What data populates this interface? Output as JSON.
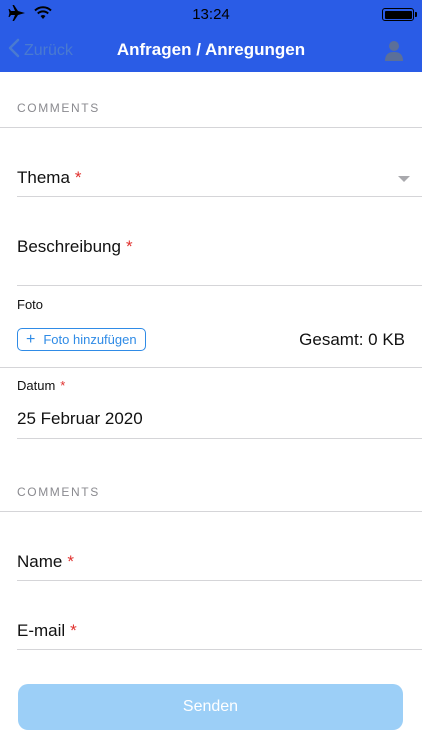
{
  "status_bar": {
    "time": "13:24"
  },
  "nav": {
    "back_label": "Zurück",
    "title": "Anfragen / Anregungen"
  },
  "section1": {
    "header": "COMMENTS",
    "thema_label": "Thema",
    "beschreibung_label": "Beschreibung",
    "foto_label": "Foto",
    "add_photo_label": "Foto hinzufügen",
    "total_label": "Gesamt: 0 KB",
    "datum_label": "Datum",
    "datum_value": "25 Februar 2020",
    "required_mark": "*"
  },
  "section2": {
    "header": "COMMENTS",
    "name_label": "Name",
    "email_label": "E-mail",
    "required_mark": "*"
  },
  "send_button": {
    "label": "Senden"
  },
  "colors": {
    "nav_bg": "#2a5ce6",
    "accent": "#2f8be6",
    "required": "#e0302d",
    "send_disabled": "#9ccff7"
  }
}
